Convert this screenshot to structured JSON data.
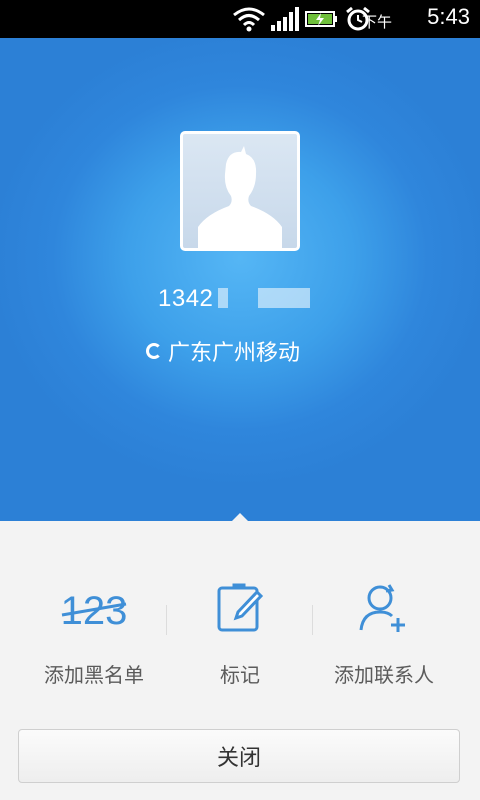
{
  "status_bar": {
    "ampm": "下午",
    "time": "5:43",
    "icons": [
      "wifi-icon",
      "signal-icon",
      "battery-icon",
      "alarm-icon"
    ]
  },
  "caller": {
    "number": "1342",
    "location": "广东广州移动"
  },
  "actions": [
    {
      "label": "添加黑名单",
      "icon": "blocklist-123-icon"
    },
    {
      "label": "标记",
      "icon": "edit-mark-icon"
    },
    {
      "label": "添加联系人",
      "icon": "add-contact-icon"
    }
  ],
  "close_button": {
    "label": "关闭"
  },
  "colors": {
    "accent": "#2f86dc",
    "icon_blue": "#3f8fd7"
  }
}
